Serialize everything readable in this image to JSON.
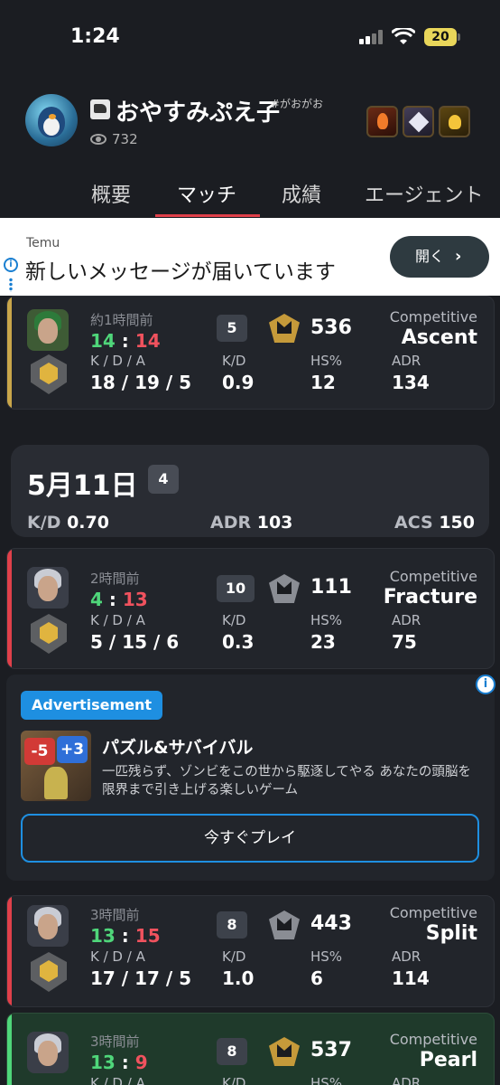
{
  "status_bar": {
    "time": "1:24",
    "battery": "20"
  },
  "profile": {
    "name": "おやすみぷえ子",
    "tag": "#がおがお",
    "views": "732"
  },
  "tabs": [
    "概要",
    "マッチ",
    "成績",
    "エージェント"
  ],
  "ad_banner": {
    "source": "Temu",
    "headline": "新しいメッセージが届いています",
    "button": "開く",
    "info": "i"
  },
  "labels": {
    "kda": "K / D / A",
    "kd": "K/D",
    "hs": "HS%",
    "adr": "ADR"
  },
  "matches": [
    {
      "time_ago": "約1時間前",
      "score_win": "14",
      "score_loss": "14",
      "kda": "18 / 19 / 5",
      "kd": "0.9",
      "hs": "12",
      "adr": "134",
      "placement": "5",
      "rr": "536",
      "mode": "Competitive",
      "map": "Ascent",
      "result_color": "#c9a64a"
    },
    {
      "time_ago": "2時間前",
      "score_win": "4",
      "score_loss": "13",
      "kda": "5 / 15 / 6",
      "kd": "0.3",
      "hs": "23",
      "adr": "75",
      "placement": "10",
      "rr": "111",
      "mode": "Competitive",
      "map": "Fracture",
      "result_color": "#e0404a"
    },
    {
      "time_ago": "3時間前",
      "score_win": "13",
      "score_loss": "15",
      "kda": "17 / 17 / 5",
      "kd": "1.0",
      "hs": "6",
      "adr": "114",
      "placement": "8",
      "rr": "443",
      "mode": "Competitive",
      "map": "Split",
      "result_color": "#e0404a"
    },
    {
      "time_ago": "3時間前",
      "score_win": "13",
      "score_loss": "9",
      "kda": "",
      "kd": "",
      "hs": "",
      "adr": "",
      "placement": "8",
      "rr": "537",
      "mode": "Competitive",
      "map": "Pearl",
      "result_color": "#4fd67a"
    }
  ],
  "day_summary": {
    "date": "5月11日",
    "count": "4",
    "kd_label": "K/D",
    "kd": "0.70",
    "adr_label": "ADR",
    "adr": "103",
    "acs_label": "ACS",
    "acs": "150"
  },
  "sponsored": {
    "tag": "Advertisement",
    "thumb_red": "-5",
    "thumb_blue": "+3",
    "title": "パズル&サバイバル",
    "description": "一匹残らず、ゾンビをこの世から駆逐してやる あなたの頭脳を限界まで引き上げる楽しいゲーム",
    "button": "今すぐプレイ",
    "info": "i"
  },
  "colors": {
    "win": "#4fd67a",
    "loss": "#f0525e",
    "accent": "#e0404a",
    "ad_blue": "#1e8fe1"
  }
}
